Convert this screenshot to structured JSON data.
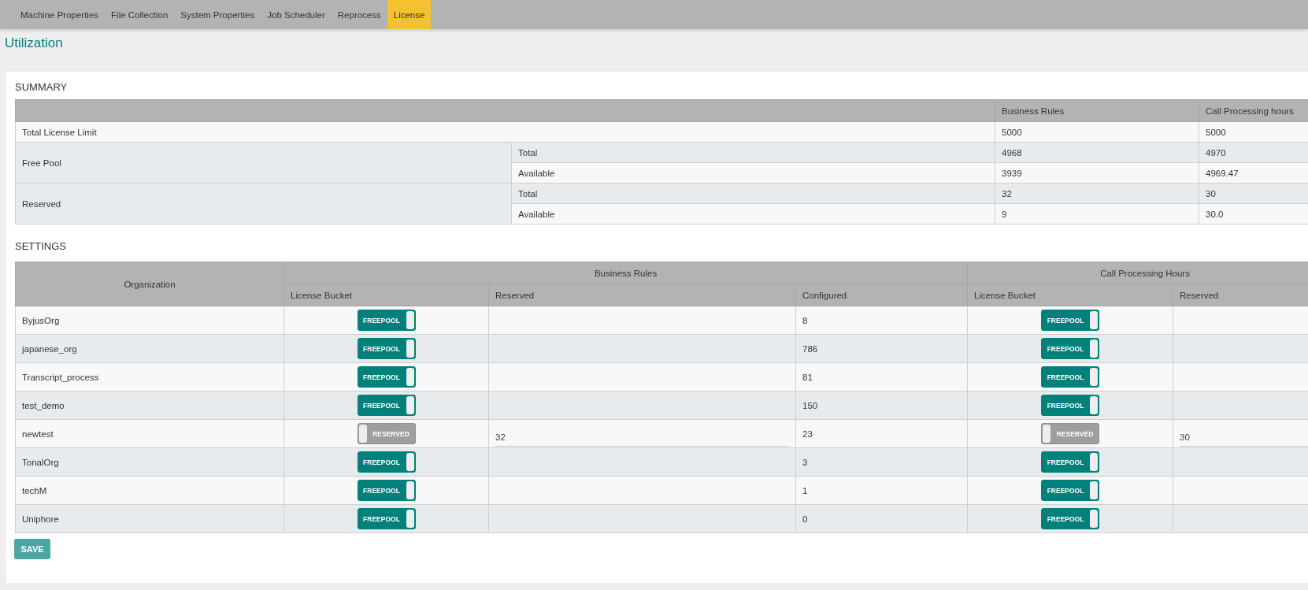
{
  "nav": {
    "tabs": [
      {
        "label": "Machine Properties",
        "selected": false
      },
      {
        "label": "File Collection",
        "selected": false
      },
      {
        "label": "System Properties",
        "selected": false
      },
      {
        "label": "Job Scheduler",
        "selected": false
      },
      {
        "label": "Reprocess",
        "selected": false
      },
      {
        "label": "License",
        "selected": true
      }
    ]
  },
  "title": "Utilization",
  "summary": {
    "heading": "SUMMARY",
    "columns": [
      "Business Rules",
      "Call Processing hours"
    ],
    "rows": [
      {
        "label": "Total License Limit",
        "values": [
          "5000",
          "5000"
        ]
      },
      {
        "label": "Free Pool",
        "sub": [
          {
            "label": "Total",
            "values": [
              "4968",
              "4970"
            ]
          },
          {
            "label": "Available",
            "values": [
              "3939",
              "4969.47"
            ]
          }
        ]
      },
      {
        "label": "Reserved",
        "sub": [
          {
            "label": "Total",
            "values": [
              "32",
              "30"
            ]
          },
          {
            "label": "Available",
            "values": [
              "9",
              "30.0"
            ]
          }
        ]
      }
    ]
  },
  "settings": {
    "heading": "SETTINGS",
    "organization_header": "Organization",
    "groups": [
      {
        "name": "Business Rules",
        "columns": [
          "License Bucket",
          "Reserved",
          "Configured"
        ]
      },
      {
        "name": "Call Processing Hours",
        "columns": [
          "License Bucket",
          "Reserved"
        ]
      }
    ],
    "rows": [
      {
        "organization": "ByjusOrg",
        "business_rules": {
          "bucket": {
            "label": "FREEPOOL",
            "on": true
          },
          "configured": "8"
        },
        "call_processing": {
          "bucket": {
            "label": "FREEPOOL",
            "on": true
          }
        }
      },
      {
        "organization": "japanese_org",
        "business_rules": {
          "bucket": {
            "label": "FREEPOOL",
            "on": true
          },
          "configured": "786"
        },
        "call_processing": {
          "bucket": {
            "label": "FREEPOOL",
            "on": true
          }
        }
      },
      {
        "organization": "Transcript_process",
        "business_rules": {
          "bucket": {
            "label": "FREEPOOL",
            "on": true
          },
          "configured": "81"
        },
        "call_processing": {
          "bucket": {
            "label": "FREEPOOL",
            "on": true
          }
        }
      },
      {
        "organization": "test_demo",
        "business_rules": {
          "bucket": {
            "label": "FREEPOOL",
            "on": true
          },
          "configured": "150"
        },
        "call_processing": {
          "bucket": {
            "label": "FREEPOOL",
            "on": true
          }
        }
      },
      {
        "organization": "newtest",
        "business_rules": {
          "bucket": {
            "label": "RESERVED",
            "on": false
          },
          "reserved": "32",
          "configured": "23"
        },
        "call_processing": {
          "bucket": {
            "label": "RESERVED",
            "on": false
          },
          "reserved": "30"
        }
      },
      {
        "organization": "TonalOrg",
        "business_rules": {
          "bucket": {
            "label": "FREEPOOL",
            "on": true
          },
          "configured": "3"
        },
        "call_processing": {
          "bucket": {
            "label": "FREEPOOL",
            "on": true
          }
        }
      },
      {
        "organization": "techM",
        "business_rules": {
          "bucket": {
            "label": "FREEPOOL",
            "on": true
          },
          "configured": "1"
        },
        "call_processing": {
          "bucket": {
            "label": "FREEPOOL",
            "on": true
          }
        }
      },
      {
        "organization": "Uniphore",
        "business_rules": {
          "bucket": {
            "label": "FREEPOOL",
            "on": true
          },
          "configured": "0"
        },
        "call_processing": {
          "bucket": {
            "label": "FREEPOOL",
            "on": true
          }
        }
      }
    ]
  },
  "save_button": "SAVE"
}
